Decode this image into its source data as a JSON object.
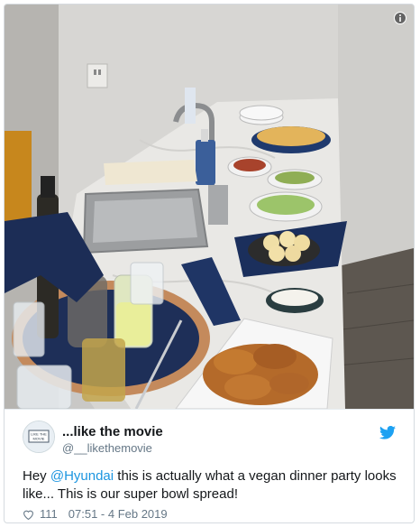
{
  "tweet": {
    "display_name": "...like the movie",
    "handle": "@__likethemovie",
    "text_before": "Hey ",
    "mention": "@Hyundai",
    "text_after": " this is actually what a vegan dinner party looks like... This is our super bowl spread!",
    "likes": "111",
    "timestamp": "07:51 - 4 Feb 2019",
    "avatar_text": "LIKE THE MOVIE"
  },
  "icons": {
    "info": "info-icon",
    "bird": "twitter-bird-icon",
    "heart": "heart-icon"
  },
  "colors": {
    "accent": "#1da1f2",
    "mention": "#1b95e0",
    "secondary_text": "#657786"
  }
}
